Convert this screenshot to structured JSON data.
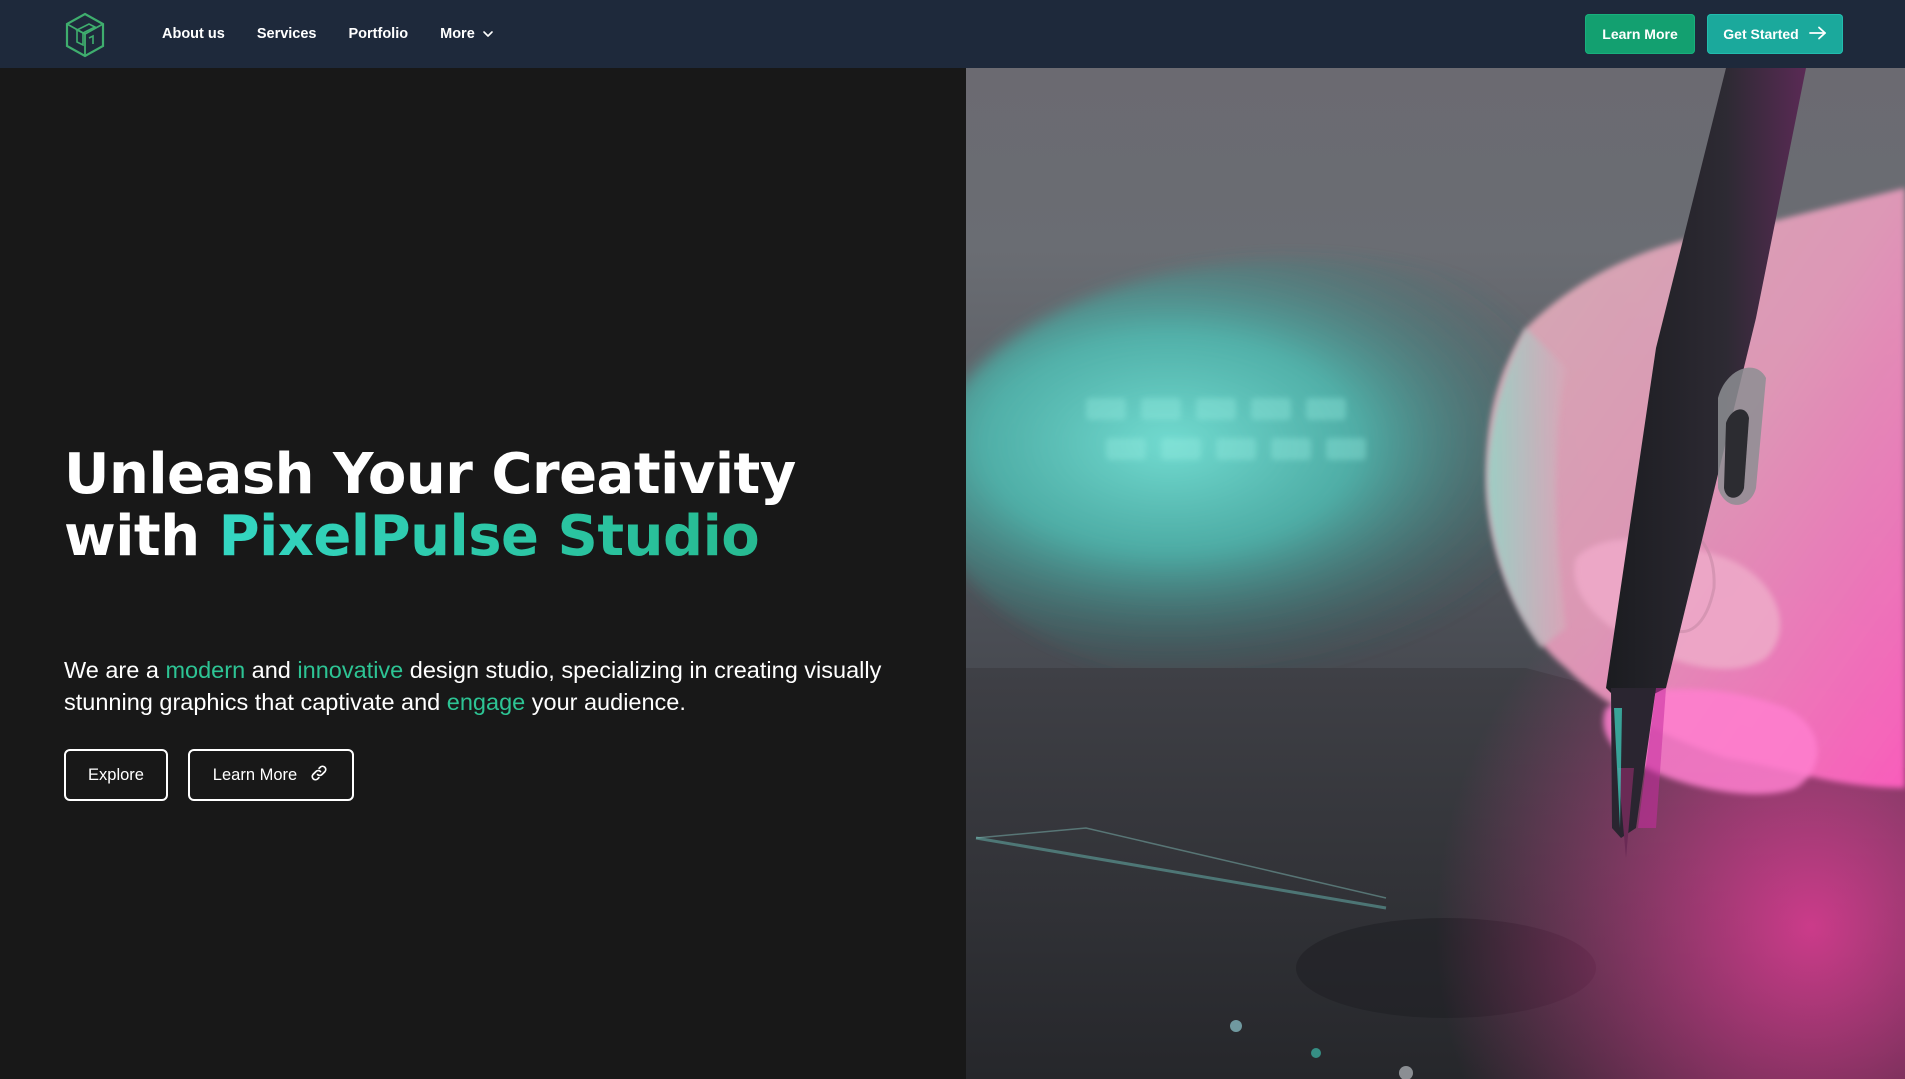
{
  "brand": {
    "logo_icon": "isometric-cube-logo",
    "accent_color": "#13a070",
    "secondary_color": "#1ba99c",
    "highlight_color": "#2dc494"
  },
  "nav": {
    "links": [
      {
        "label": "About us"
      },
      {
        "label": "Services"
      },
      {
        "label": "Portfolio"
      },
      {
        "label": "More",
        "icon": "chevron-down-icon"
      }
    ],
    "learn_more_label": "Learn More",
    "get_started_label": "Get Started",
    "get_started_icon": "arrow-right-icon"
  },
  "hero": {
    "headline_line1": "Unleash Your Creativity",
    "headline_line2_prefix": "with ",
    "headline_line2_accent": "PixelPulse Studio",
    "tagline": {
      "t1": "We are a ",
      "h1": "modern",
      "t2": " and ",
      "h2": "innovative",
      "t3": " design studio, specializing in creating visually stunning graphics that captivate and ",
      "h3": "engage",
      "t4": " your audience."
    },
    "explore_label": "Explore",
    "learn_more_label": "Learn More",
    "learn_more_icon": "link-icon",
    "image_subject": "hand-holding-stylus-on-drawing-tablet"
  }
}
